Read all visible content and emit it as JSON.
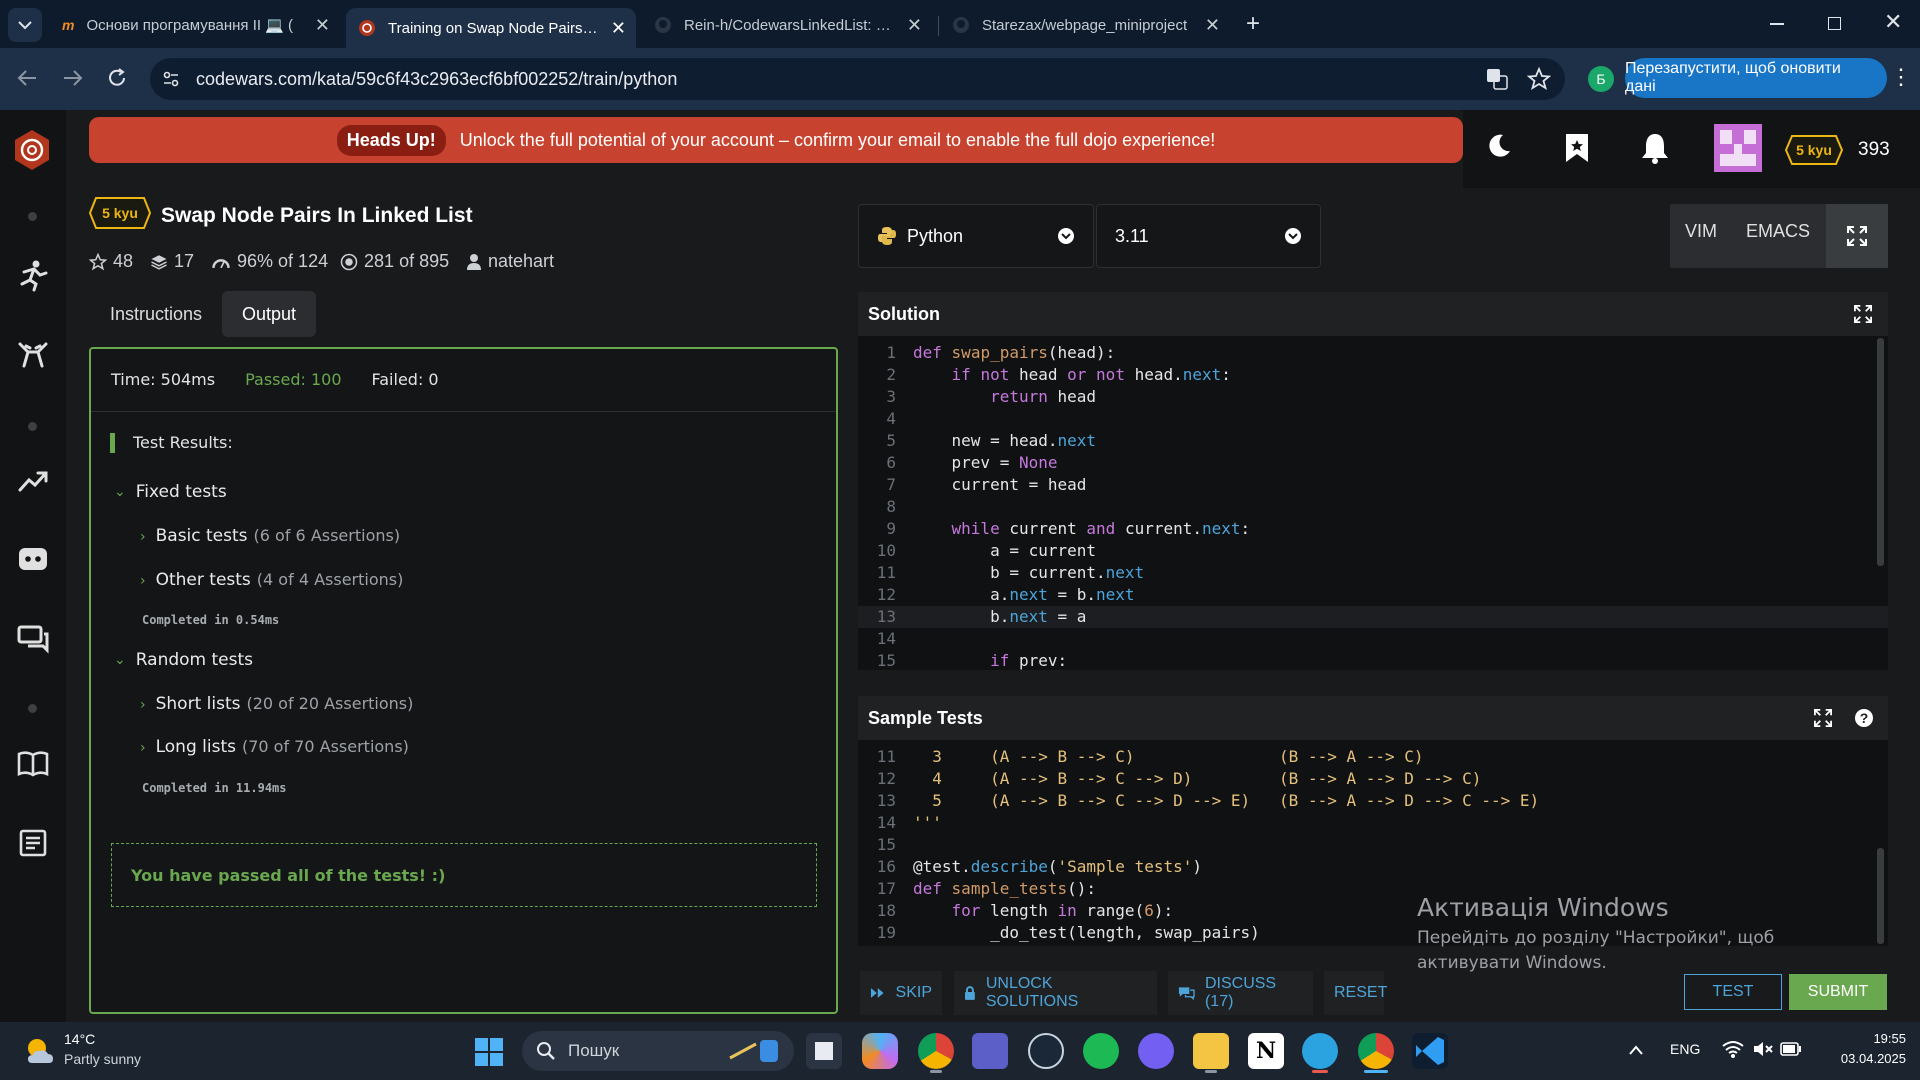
{
  "browser": {
    "tabs": [
      {
        "title": "Основи програмування II 💻 (",
        "favicon": "moodle-icon"
      },
      {
        "title": "Training on Swap Node Pairs In",
        "favicon": "codewars-icon",
        "active": true
      },
      {
        "title": "Rein-h/CodewarsLinkedList: Rep",
        "favicon": "github-icon"
      },
      {
        "title": "Starezax/webpage_miniproject",
        "favicon": "github-icon"
      }
    ],
    "url": "codewars.com/kata/59c6f43c2963ecf6bf002252/train/python",
    "profile_initial": "Б",
    "restart_label": "Перезапустити, щоб оновити дані"
  },
  "banner": {
    "badge": "Heads Up!",
    "text": "Unlock the full potential of your account – confirm your email to enable the full dojo experience!"
  },
  "user": {
    "rank": "5 kyu",
    "honor": "393"
  },
  "kata": {
    "rank": "5 kyu",
    "title": "Swap Node Pairs In Linked List",
    "stars": "48",
    "collections": "17",
    "satisfaction": "96%",
    "satisfaction_of": "of 124",
    "completed": "281",
    "completed_of": "of 895",
    "author": "natehart"
  },
  "left_tabs": {
    "instructions": "Instructions",
    "output": "Output"
  },
  "output": {
    "time": "Time: 504ms",
    "passed": "Passed: 100",
    "failed": "Failed: 0",
    "heading": "Test Results:",
    "groups": [
      {
        "name": "Fixed tests",
        "subs": [
          {
            "name": "Basic tests",
            "count": "(6 of 6 Assertions)"
          },
          {
            "name": "Other tests",
            "count": "(4 of 4 Assertions)"
          }
        ],
        "completed": "Completed in 0.54ms"
      },
      {
        "name": "Random tests",
        "subs": [
          {
            "name": "Short lists",
            "count": "(20 of 20 Assertions)"
          },
          {
            "name": "Long lists",
            "count": "(70 of 70 Assertions)"
          }
        ],
        "completed": "Completed in 11.94ms"
      }
    ],
    "pass_message": "You have passed all of the tests! :)"
  },
  "editor": {
    "language": "Python",
    "version": "3.11",
    "vim": "VIM",
    "emacs": "EMACS",
    "solution_title": "Solution",
    "sample_title": "Sample Tests",
    "current_line": 13
  },
  "solution_code": [
    {
      "n": "1",
      "html": "<span class='kw'>def</span> <span class='fn'>swap_pairs</span>(head):"
    },
    {
      "n": "2",
      "html": "    <span class='kw'>if</span> <span class='kw'>not</span> head <span class='kw'>or</span> <span class='kw'>not</span> head.<span class='at'>next</span>:"
    },
    {
      "n": "3",
      "html": "        <span class='kw'>return</span> head"
    },
    {
      "n": "4",
      "html": ""
    },
    {
      "n": "5",
      "html": "    new = head.<span class='at'>next</span>"
    },
    {
      "n": "6",
      "html": "    prev = <span class='cn'>None</span>"
    },
    {
      "n": "7",
      "html": "    current = head"
    },
    {
      "n": "8",
      "html": ""
    },
    {
      "n": "9",
      "html": "    <span class='kw'>while</span> current <span class='kw'>and</span> current.<span class='at'>next</span>:"
    },
    {
      "n": "10",
      "html": "        a = current"
    },
    {
      "n": "11",
      "html": "        b = current.<span class='at'>next</span>"
    },
    {
      "n": "12",
      "html": "        a.<span class='at'>next</span> = b.<span class='at'>next</span>"
    },
    {
      "n": "13",
      "html": "        b.<span class='at'>next</span> = a"
    },
    {
      "n": "14",
      "html": ""
    },
    {
      "n": "15",
      "html": "        <span class='kw'>if</span> prev:"
    }
  ],
  "sample_code": [
    {
      "n": "11",
      "html": "<span class='ys'>  3     (A --&gt; B --&gt; C)               (B --&gt; A --&gt; C)</span>"
    },
    {
      "n": "12",
      "html": "<span class='ys'>  4     (A --&gt; B --&gt; C --&gt; D)         (B --&gt; A --&gt; D --&gt; C)</span>"
    },
    {
      "n": "13",
      "html": "<span class='ys'>  5     (A --&gt; B --&gt; C --&gt; D --&gt; E)   (B --&gt; A --&gt; D --&gt; C --&gt; E)</span>"
    },
    {
      "n": "14",
      "html": "<span class='ys'>'''</span>"
    },
    {
      "n": "15",
      "html": ""
    },
    {
      "n": "16",
      "html": "@test.<span class='at'>describe</span>(<span class='ys'>'Sample tests'</span>)"
    },
    {
      "n": "17",
      "html": "<span class='kw'>def</span> <span class='fn'>sample_tests</span>():"
    },
    {
      "n": "18",
      "html": "    <span class='kw'>for</span> length <span class='kw'>in</span> range(<span class='num'>6</span>):"
    },
    {
      "n": "19",
      "html": "        _do_test(length, swap_pairs)"
    }
  ],
  "actions": {
    "skip": "SKIP",
    "unlock": "UNLOCK SOLUTIONS",
    "discuss": "DISCUSS (17)",
    "reset": "RESET",
    "test": "TEST",
    "submit": "SUBMIT"
  },
  "watermark": {
    "title": "Активація Windows",
    "text": "Перейдіть до розділу \"Настройки\", щоб активувати Windows."
  },
  "taskbar": {
    "weather_temp": "14°C",
    "weather_desc": "Partly sunny",
    "search_placeholder": "Пошук",
    "lang": "ENG",
    "time": "19:55",
    "date": "03.04.2025"
  },
  "colors": {
    "accent_red": "#c8432f",
    "pass_green": "#6aa84f",
    "link_blue": "#4ea4d9",
    "rank_yellow": "#ecb613"
  }
}
